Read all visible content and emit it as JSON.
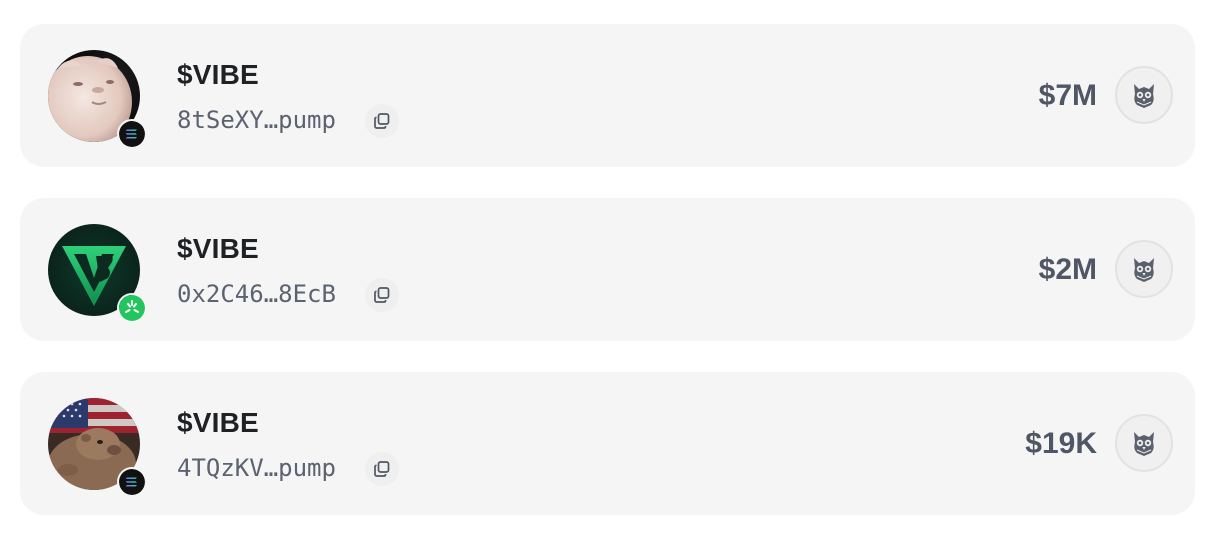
{
  "tokens": [
    {
      "ticker": "$VIBE",
      "address": "8tSeXY…pump",
      "market_cap": "$7M",
      "avatar_icon": "cat-avatar-icon",
      "chain_icon": "solana-icon"
    },
    {
      "ticker": "$VIBE",
      "address": "0x2C46…8EcB",
      "market_cap": "$2M",
      "avatar_icon": "vb-logo-icon",
      "chain_icon": "green-chain-icon"
    },
    {
      "ticker": "$VIBE",
      "address": "4TQzKV…pump",
      "market_cap": "$19K",
      "avatar_icon": "capybara-flag-icon",
      "chain_icon": "solana-icon"
    }
  ],
  "colors": {
    "card_bg": "#f5f5f5",
    "ticker_text": "#1f2125",
    "address_text": "#5b6270",
    "mcap_text": "#4f5664",
    "chain_green": "#22c55e",
    "solana_purple": "#9945ff",
    "solana_green": "#14f195"
  },
  "actions": {
    "copy_icon": "copy-icon",
    "owl_icon": "owl-icon"
  }
}
